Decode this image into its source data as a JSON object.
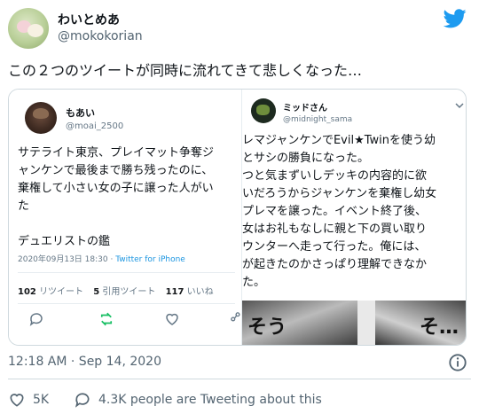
{
  "author": {
    "display_name": "わいとめあ",
    "handle": "@mokokorian"
  },
  "tweet": {
    "text": "この２つのツイートが同時に流れてきて悲しくなった…"
  },
  "left_screenshot": {
    "name": "もあい",
    "handle": "@moai_2500",
    "body_lines": [
      "サテライト東京、プレイマット争奪ジ",
      "ャンケンで最後まで勝ち残ったのに、",
      "棄権して小さい女の子に譲った人がい",
      "た"
    ],
    "signature": "デュエリストの鑑",
    "date": "2020年09月13日 18:30",
    "separator": " · ",
    "source": "Twitter for iPhone",
    "retweets_count": "102",
    "retweets_label": "リツイート",
    "quotes_count": "5",
    "quotes_label": "引用ツイート",
    "likes_count": "117",
    "likes_label": "いいね"
  },
  "right_screenshot": {
    "name": "ミッドさん",
    "handle": "@midnight_sama",
    "body_lines": [
      "レマジャンケンでEvil★Twinを使う幼",
      "とサシの勝負になった。",
      "つと気まずいしデッキの内容的に欲",
      "いだろうからジャンケンを棄権し幼女",
      "プレマを譲った。イベント終了後、",
      "女はお礼もなしに親と下の買い取り",
      "ウンターへ走って行った。俺には、",
      "が起きたのかさっぱり理解できなか",
      "た。"
    ],
    "manga_text_left": "そう",
    "manga_text_right": "そ…"
  },
  "meta": {
    "timestamp": "12:18 AM · Sep 14, 2020"
  },
  "footer": {
    "likes": "5K",
    "people_text": "4.3K people are Tweeting about this"
  },
  "colors": {
    "twitter_blue": "#1d9bf0",
    "retweet_green": "#17bf63",
    "muted": "#536471"
  },
  "icons": [
    "twitter-logo-icon",
    "heart-icon",
    "reply-icon",
    "retweet-icon",
    "share-icon",
    "info-icon",
    "chevron-down-icon"
  ]
}
